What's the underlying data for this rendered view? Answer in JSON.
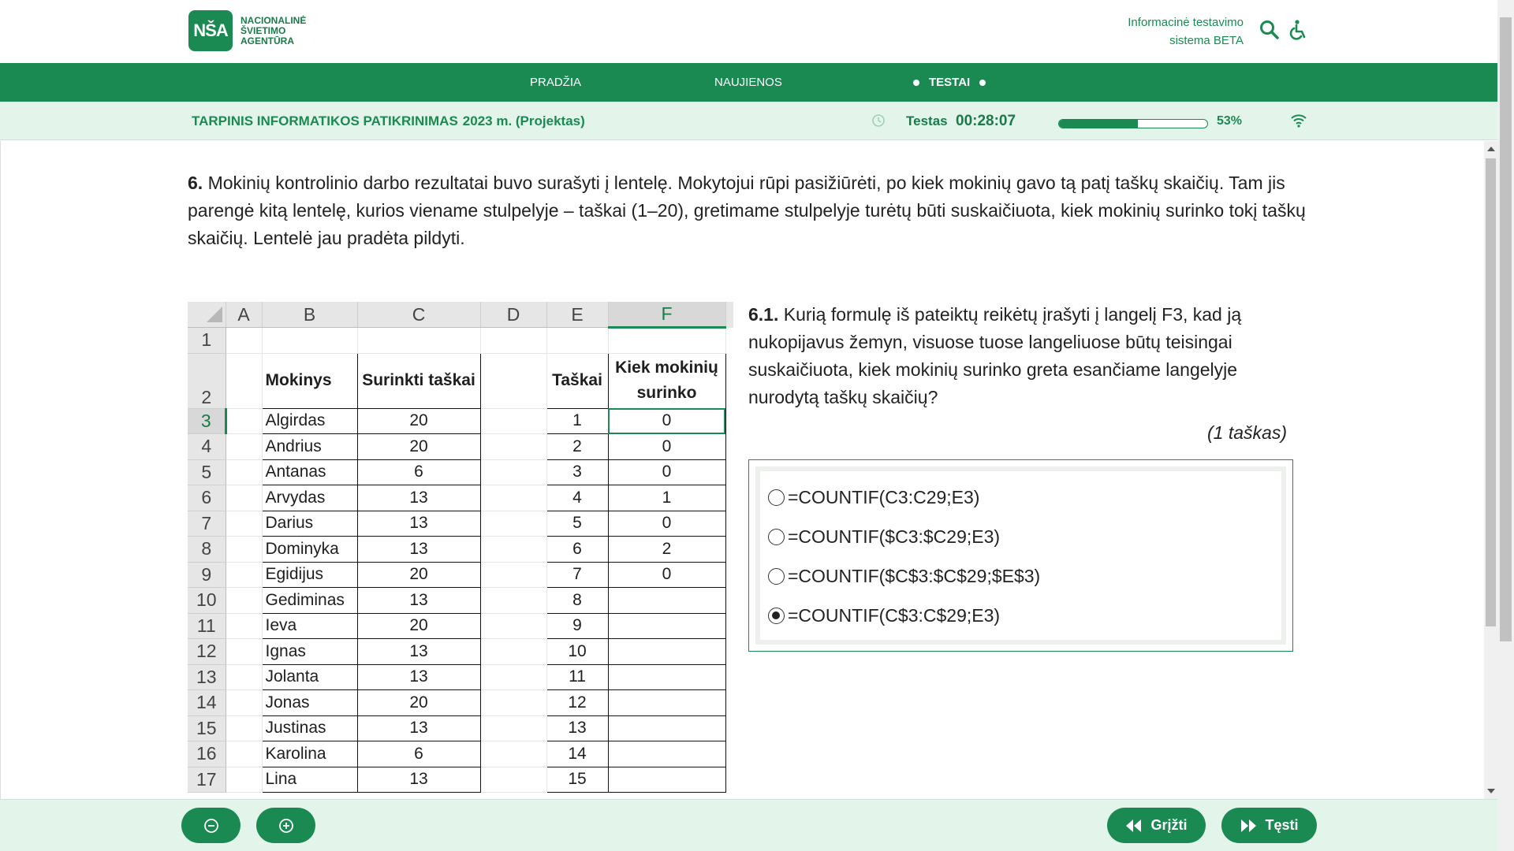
{
  "header": {
    "logo_mark": "NŠA",
    "logo_lines": [
      "NACIONALINĖ",
      "ŠVIETIMO",
      "AGENTŪRA"
    ],
    "system_title_line1": "Informacinė testavimo",
    "system_title_line2": "sistema BETA",
    "icons": [
      "search-icon",
      "accessibility-icon"
    ]
  },
  "nav": {
    "items": [
      "PRADŽIA",
      "NAUJIENOS",
      "TESTAI"
    ],
    "active": "TESTAI"
  },
  "status": {
    "exam_title": "TARPINIS INFORMATIKOS PATIKRINIMAS",
    "exam_year": "2023 m. (Projektas)",
    "test_label": "Testas",
    "timer": "00:28:07",
    "progress_fraction": 0.53,
    "progress_text": "53%"
  },
  "question": {
    "number": "6.",
    "text": "Mokinių kontrolinio darbo rezultatai buvo surašyti į lentelę. Mokytojui rūpi pasižiūrėti, po kiek mokinių gavo tą patį taškų skaičių. Tam jis parengė kitą lentelę, kurios viename stulpelyje – taškai (1–20), gretimame stulpelyje turėtų būti suskaičiuota, kiek mokinių surinko tokį taškų skaičių. Lentelė jau pradėta pildyti."
  },
  "spreadsheet": {
    "columns": [
      "A",
      "B",
      "C",
      "D",
      "E",
      "F"
    ],
    "header_row": {
      "row_num": "2",
      "B": "Mokinys",
      "C": "Surinkti taškai",
      "E": "Taškai",
      "F_line1": "Kiek mokinių",
      "F_line2": "surinko"
    },
    "rows": [
      {
        "n": "3",
        "B": "Algirdas",
        "C": "20",
        "E": "1",
        "F": "0"
      },
      {
        "n": "4",
        "B": "Andrius",
        "C": "20",
        "E": "2",
        "F": "0"
      },
      {
        "n": "5",
        "B": "Antanas",
        "C": "6",
        "E": "3",
        "F": "0"
      },
      {
        "n": "6",
        "B": "Arvydas",
        "C": "13",
        "E": "4",
        "F": "1"
      },
      {
        "n": "7",
        "B": "Darius",
        "C": "13",
        "E": "5",
        "F": "0"
      },
      {
        "n": "8",
        "B": "Dominyka",
        "C": "13",
        "E": "6",
        "F": "2"
      },
      {
        "n": "9",
        "B": "Egidijus",
        "C": "20",
        "E": "7",
        "F": "0"
      },
      {
        "n": "10",
        "B": "Gediminas",
        "C": "13",
        "E": "8",
        "F": ""
      },
      {
        "n": "11",
        "B": "Ieva",
        "C": "20",
        "E": "9",
        "F": ""
      },
      {
        "n": "12",
        "B": "Ignas",
        "C": "13",
        "E": "10",
        "F": ""
      },
      {
        "n": "13",
        "B": "Jolanta",
        "C": "13",
        "E": "11",
        "F": ""
      },
      {
        "n": "14",
        "B": "Jonas",
        "C": "20",
        "E": "12",
        "F": ""
      },
      {
        "n": "15",
        "B": "Justinas",
        "C": "13",
        "E": "13",
        "F": ""
      },
      {
        "n": "16",
        "B": "Karolina",
        "C": "6",
        "E": "14",
        "F": ""
      },
      {
        "n": "17",
        "B": "Lina",
        "C": "13",
        "E": "15",
        "F": ""
      }
    ]
  },
  "subquestion": {
    "number": "6.1.",
    "text": "Kurią formulę iš pateiktų reikėtų įrašyti į langelį F3, kad ją nukopijavus žemyn, visuose tuose langeliuose būtų teisingai suskaičiuota, kiek mokinių surinko greta esančiame langelyje nurodytą taškų skaičių?",
    "points": "(1 taškas)"
  },
  "answers": {
    "options": [
      "=COUNTIF(C3:C29;E3)",
      "=COUNTIF($C3:$C29;E3)",
      "=COUNTIF($C$3:$C$29;$E$3)",
      "=COUNTIF(C$3:C$29;E3)"
    ],
    "selected_index": 3
  },
  "footer": {
    "back_label": "Grįžti",
    "next_label": "Tęsti",
    "icons": [
      "zoom-out-icon",
      "zoom-in-icon"
    ]
  },
  "colors": {
    "brand": "#1b8a52",
    "status_bg": "#e3f5ea"
  }
}
